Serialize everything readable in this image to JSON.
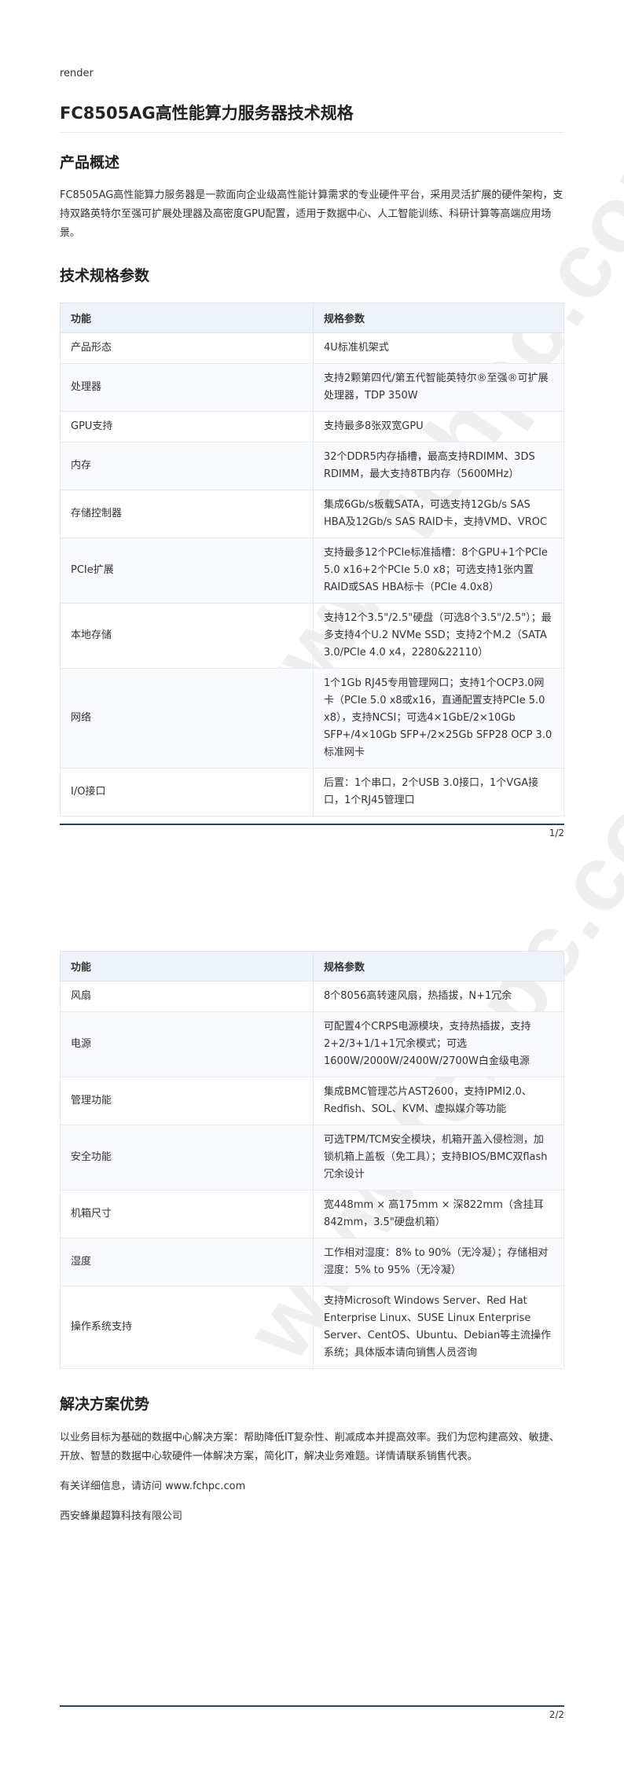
{
  "render_label": "render",
  "title": "FC8505AG高性能算力服务器技术规格",
  "watermark_text": "www.fchpc.com",
  "sections": {
    "overview_heading": "产品概述",
    "overview_text": "FC8505AG高性能算力服务器是一款面向企业级高性能计算需求的专业硬件平台，采用灵活扩展的硬件架构，支持双路英特尔至强可扩展处理器及高密度GPU配置，适用于数据中心、人工智能训练、科研计算等高端应用场景。",
    "spec_heading": "技术规格参数",
    "solution_heading": "解决方案优势",
    "solution_text": "以业务目标为基础的数据中心解决方案：帮助降低IT复杂性、削减成本并提高效率。我们为您构建高效、敏捷、开放、智慧的数据中心软硬件一体解决方案，简化IT，解决业务难题。详情请联系销售代表。",
    "visit_text": "有关详细信息，请访问 www.fchpc.com",
    "company": "西安蜂巢超算科技有限公司"
  },
  "table_header": {
    "feature": "功能",
    "spec": "规格参数"
  },
  "table1_rows": [
    {
      "feature": "产品形态",
      "spec": "4U标准机架式"
    },
    {
      "feature": "处理器",
      "spec": "支持2颗第四代/第五代智能英特尔®至强®可扩展处理器，TDP 350W"
    },
    {
      "feature": "GPU支持",
      "spec": "支持最多8张双宽GPU"
    },
    {
      "feature": "内存",
      "spec": "32个DDR5内存插槽，最高支持RDIMM、3DS RDIMM，最大支持8TB内存（5600MHz）"
    },
    {
      "feature": "存储控制器",
      "spec": "集成6Gb/s板载SATA，可选支持12Gb/s SAS HBA及12Gb/s SAS RAID卡，支持VMD、VROC"
    },
    {
      "feature": "PCIe扩展",
      "spec": "支持最多12个PCIe标准插槽：8个GPU+1个PCIe 5.0 x16+2个PCIe 5.0 x8；可选支持1张内置RAID或SAS HBA标卡（PCIe 4.0x8）"
    },
    {
      "feature": "本地存储",
      "spec": "支持12个3.5\"/2.5\"硬盘（可选8个3.5\"/2.5\"）；最多支持4个U.2 NVMe SSD；支持2个M.2（SATA 3.0/PCIe 4.0 x4，2280&22110）"
    },
    {
      "feature": "网络",
      "spec": "1个1Gb RJ45专用管理网口；支持1个OCP3.0网卡（PCIe 5.0 x8或x16，直通配置支持PCIe 5.0 x8），支持NCSI；可选4×1GbE/2×10Gb SFP+/4×10Gb SFP+/2×25Gb SFP28 OCP 3.0标准网卡"
    },
    {
      "feature": "I/O接口",
      "spec": "后置：1个串口，2个USB 3.0接口，1个VGA接口，1个RJ45管理口"
    }
  ],
  "table2_rows": [
    {
      "feature": "风扇",
      "spec": "8个8056高转速风扇，热插拔，N+1冗余"
    },
    {
      "feature": "电源",
      "spec": "可配置4个CRPS电源模块，支持热插拔，支持2+2/3+1/1+1冗余模式；可选1600W/2000W/2400W/2700W白金级电源"
    },
    {
      "feature": "管理功能",
      "spec": "集成BMC管理芯片AST2600，支持IPMI2.0、Redfish、SOL、KVM、虚拟媒介等功能"
    },
    {
      "feature": "安全功能",
      "spec": "可选TPM/TCM安全模块，机箱开盖入侵检测，加锁机箱上盖板（免工具）；支持BIOS/BMC双flash冗余设计"
    },
    {
      "feature": "机箱尺寸",
      "spec": "宽448mm × 高175mm × 深822mm（含挂耳842mm，3.5\"硬盘机箱）"
    },
    {
      "feature": "湿度",
      "spec": "工作相对湿度：8% to 90%（无冷凝）；存储相对湿度：5% to 95%（无冷凝）"
    },
    {
      "feature": "操作系统支持",
      "spec": "支持Microsoft Windows Server、Red Hat Enterprise Linux、SUSE Linux Enterprise Server、CentOS、Ubuntu、Debian等主流操作系统；具体版本请向销售人员咨询"
    }
  ],
  "page_numbers": {
    "page1": "1/2",
    "page2": "2/2"
  }
}
